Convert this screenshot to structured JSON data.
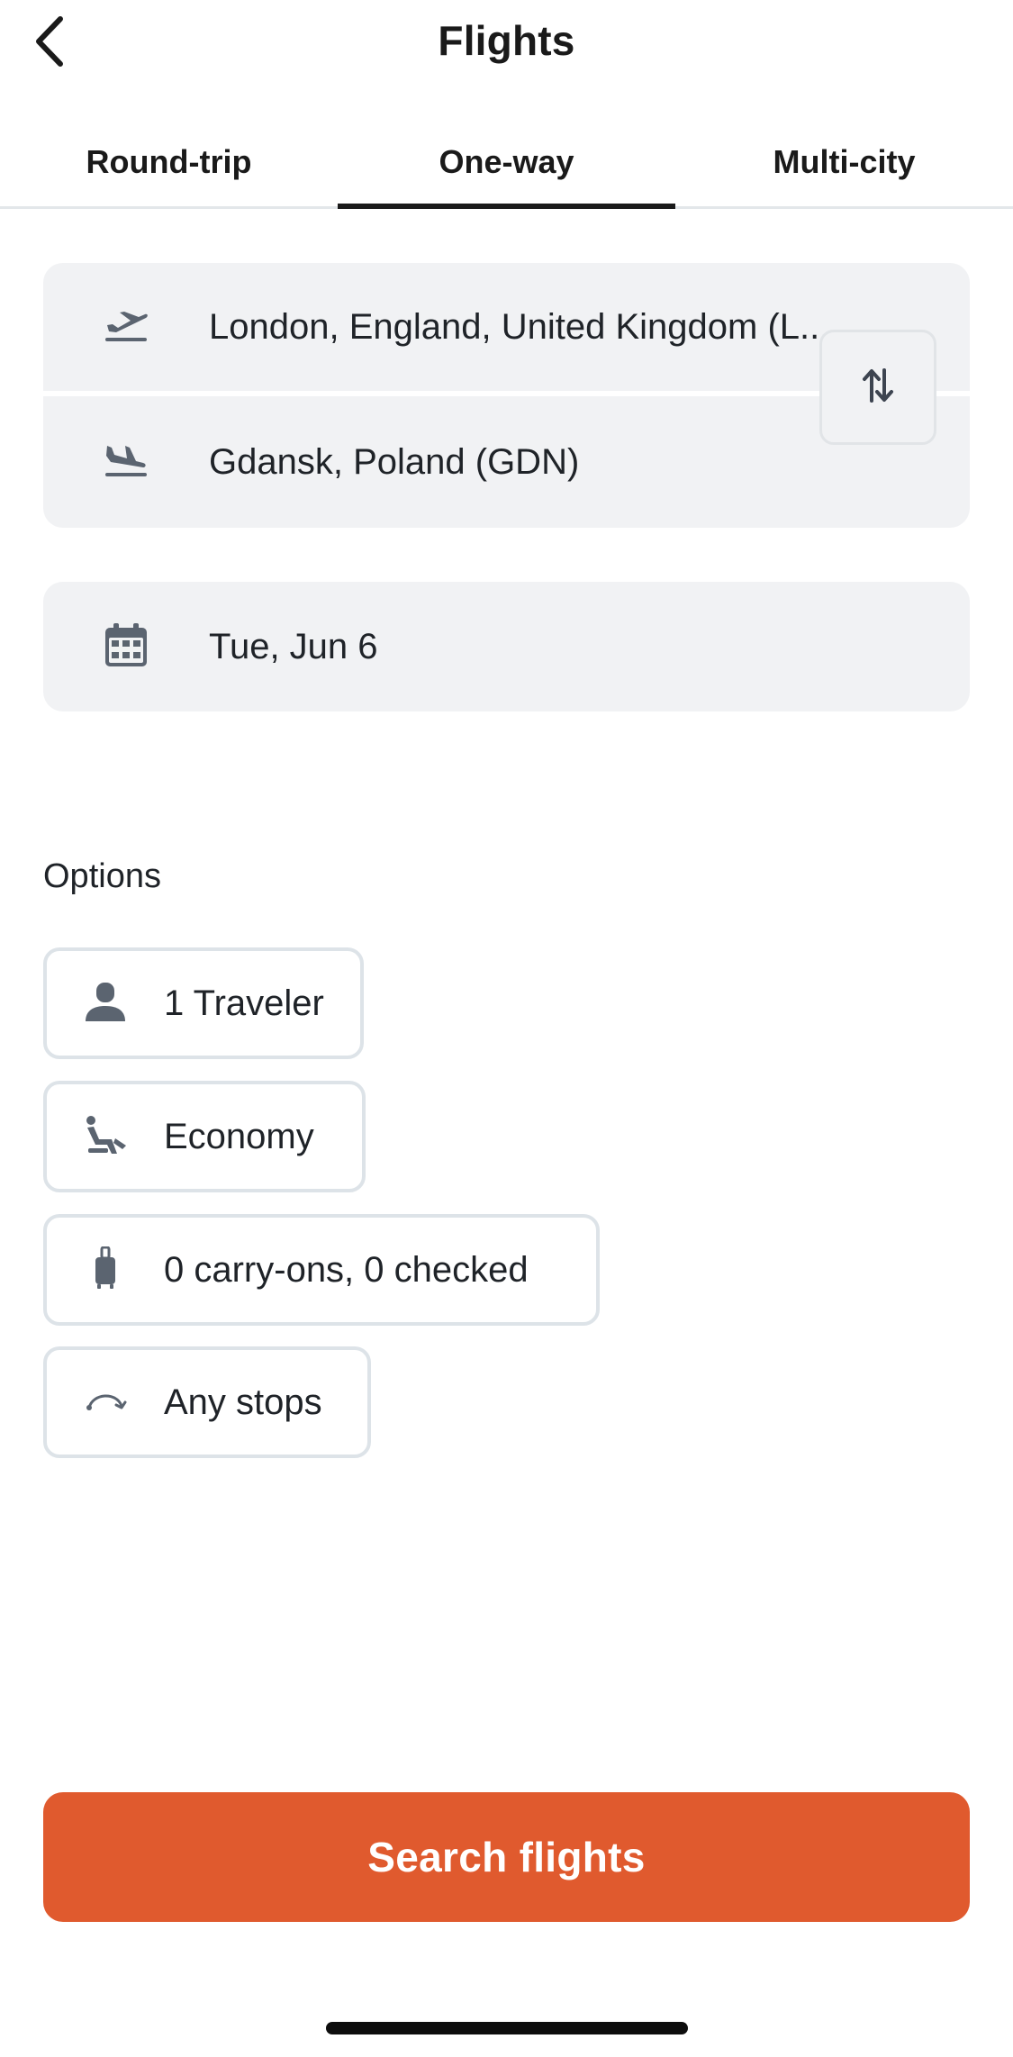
{
  "header": {
    "title": "Flights",
    "back_icon": "chevron-left-icon"
  },
  "tabs": [
    {
      "label": "Round-trip",
      "active": false
    },
    {
      "label": "One-way",
      "active": true
    },
    {
      "label": "Multi-city",
      "active": false
    }
  ],
  "route": {
    "origin": {
      "value": "London, England, United Kingdom (L...",
      "icon": "takeoff-icon"
    },
    "destination": {
      "value": "Gdansk, Poland (GDN)",
      "icon": "landing-icon"
    },
    "swap_icon": "swap-vertical-icon"
  },
  "date": {
    "value": "Tue, Jun 6",
    "icon": "calendar-icon"
  },
  "options": {
    "label": "Options",
    "travelers": {
      "value": "1 Traveler",
      "icon": "person-icon"
    },
    "cabin": {
      "value": "Economy",
      "icon": "seat-icon"
    },
    "bags": {
      "value": "0 carry-ons, 0 checked",
      "icon": "luggage-icon"
    },
    "stops": {
      "value": "Any stops",
      "icon": "stops-arc-icon"
    }
  },
  "search_button": {
    "label": "Search flights"
  },
  "colors": {
    "accent": "#e05a2e",
    "field_bg": "#f1f2f4",
    "icon": "#5b6470",
    "chip_border": "#dde3e8"
  }
}
